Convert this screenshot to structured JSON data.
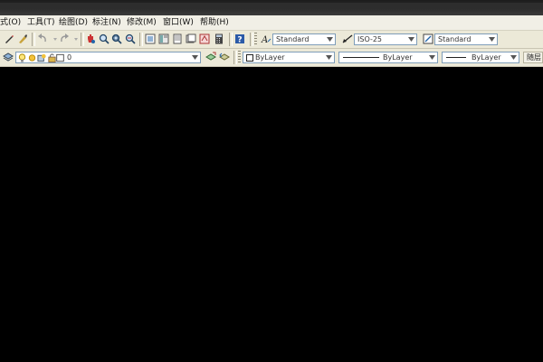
{
  "menu": [
    {
      "label": "式(O)"
    },
    {
      "label": "工具(T)"
    },
    {
      "label": "绘图(D)"
    },
    {
      "label": "标注(N)"
    },
    {
      "label": "修改(M)"
    },
    {
      "label": "窗口(W)"
    },
    {
      "label": "帮助(H)"
    }
  ],
  "styles": {
    "text_style": "Standard",
    "dim_style": "ISO-25",
    "table_style": "Standard"
  },
  "layers": {
    "current_layer": "0"
  },
  "properties": {
    "color": "ByLayer",
    "linetype": "ByLayer",
    "lineweight": "ByLayer",
    "plotstyle": "随层"
  },
  "icons": {
    "pencil": "pencil-icon",
    "brush": "paint-brush-icon",
    "undo": "undo-icon",
    "redo": "redo-icon",
    "pan": "pan-hand-icon",
    "zoom_realtime": "zoom-realtime-icon",
    "zoom_window": "zoom-window-icon",
    "zoom_previous": "zoom-previous-icon",
    "properties": "properties-icon",
    "design_center": "design-center-icon",
    "tool_palettes": "tool-palettes-icon",
    "sheet_set": "sheet-set-icon",
    "markup": "markup-icon",
    "calculator": "calculator-icon",
    "help": "help-icon",
    "text_style": "text-style-icon",
    "dim_style": "dimension-style-icon",
    "table_style": "table-style-icon",
    "layer_manager": "layer-manager-icon",
    "layer_previous": "layer-previous-icon"
  },
  "colors": {
    "canvas": "#000000",
    "chrome": "#ece9d8",
    "accent": "#2b5aa8"
  }
}
